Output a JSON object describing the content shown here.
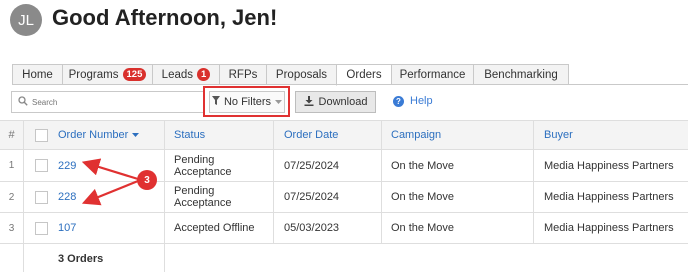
{
  "header": {
    "avatar_initials": "JL",
    "greeting": "Good Afternoon, Jen!"
  },
  "tabs": [
    {
      "label": "Home",
      "badge": null
    },
    {
      "label": "Programs",
      "badge": "125"
    },
    {
      "label": "Leads",
      "badge": "1"
    },
    {
      "label": "RFPs",
      "badge": null
    },
    {
      "label": "Proposals",
      "badge": null
    },
    {
      "label": "Orders",
      "badge": null,
      "active": true
    },
    {
      "label": "Performance",
      "badge": null
    },
    {
      "label": "Benchmarking",
      "badge": null
    }
  ],
  "toolbar": {
    "search_placeholder": "Search",
    "filter_label": "No Filters",
    "download_label": "Download",
    "help_label": "Help"
  },
  "table": {
    "columns": {
      "index": "#",
      "order_number": "Order Number",
      "status": "Status",
      "order_date": "Order Date",
      "campaign": "Campaign",
      "buyer": "Buyer"
    },
    "rows": [
      {
        "index": "1",
        "order_number": "229",
        "status": "Pending Acceptance",
        "order_date": "07/25/2024",
        "campaign": "On the Move",
        "buyer": "Media Happiness Partners"
      },
      {
        "index": "2",
        "order_number": "228",
        "status": "Pending Acceptance",
        "order_date": "07/25/2024",
        "campaign": "On the Move",
        "buyer": "Media Happiness Partners"
      },
      {
        "index": "3",
        "order_number": "107",
        "status": "Accepted Offline",
        "order_date": "05/03/2023",
        "campaign": "On the Move",
        "buyer": "Media Happiness Partners"
      }
    ],
    "footer": "3 Orders"
  },
  "annotation": {
    "marker_label": "3",
    "color": "#e03131"
  },
  "colors": {
    "link": "#2c6fbf",
    "badge": "#d9302c",
    "highlight": "#e03131"
  }
}
